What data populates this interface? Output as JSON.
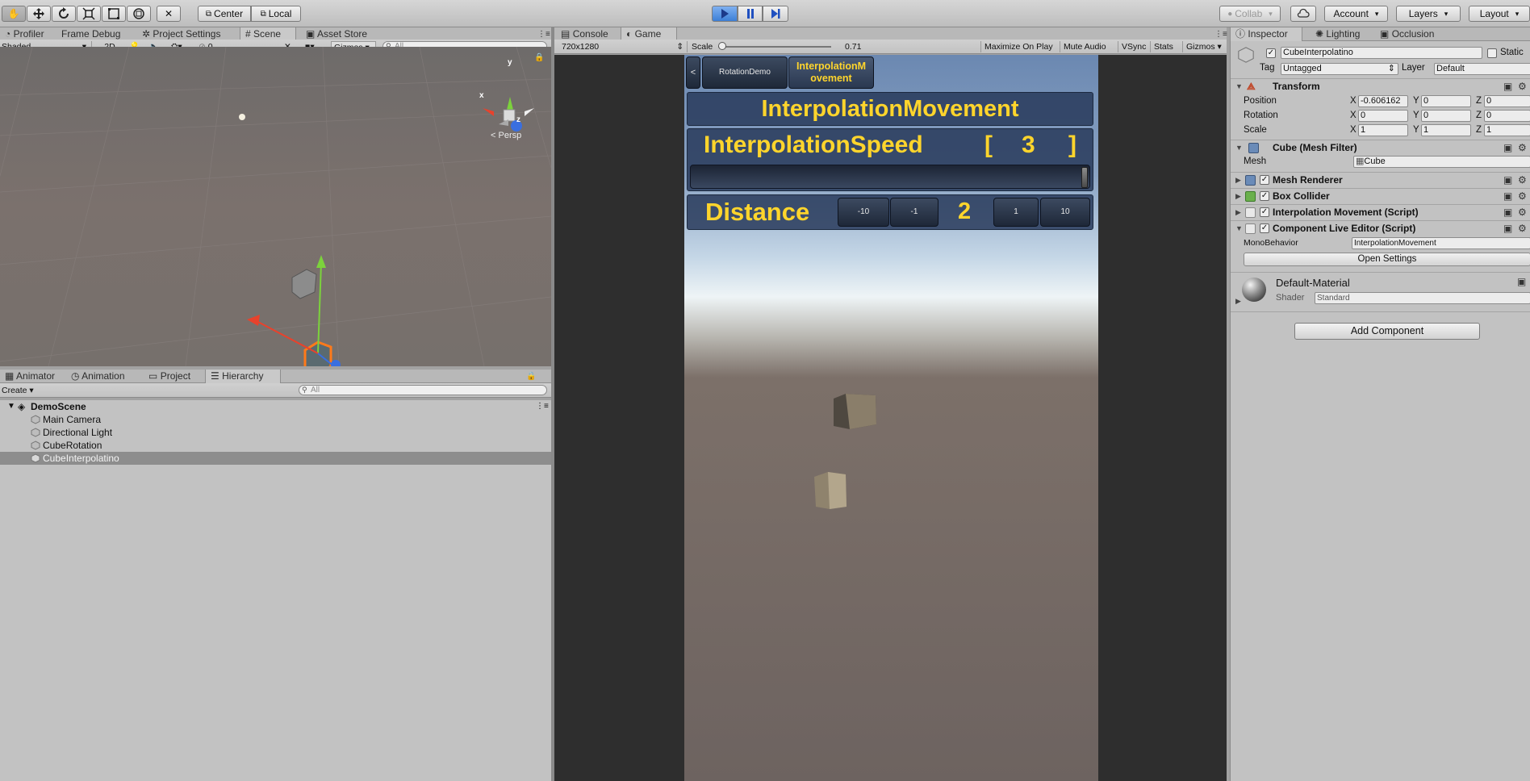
{
  "toolbar": {
    "pivot_center": "Center",
    "pivot_local": "Local",
    "collab": "Collab",
    "account": "Account",
    "layers": "Layers",
    "layout": "Layout"
  },
  "scene_tabs": [
    "Profiler",
    "Frame Debug",
    "Project Settings",
    "Scene",
    "Asset Store"
  ],
  "scene_bar": {
    "shading": "Shaded",
    "mode_2d": "2D",
    "fx_count": "0",
    "gizmos": "Gizmos",
    "search_placeholder": "All",
    "persp": "Persp",
    "axis_x": "x",
    "axis_y": "y",
    "axis_z": "z"
  },
  "hier_tabs": [
    "Animator",
    "Animation",
    "Project",
    "Hierarchy"
  ],
  "hierarchy": {
    "create": "Create",
    "search_placeholder": "All",
    "scene_name": "DemoScene",
    "items": [
      "Main Camera",
      "Directional Light",
      "CubeRotation",
      "CubeInterpolatino"
    ]
  },
  "game_tabs": [
    "Console",
    "Game"
  ],
  "game_bar": {
    "resolution": "720x1280",
    "scale_label": "Scale",
    "scale_value": "0.71",
    "scale_fraction": 0.0,
    "maximize": "Maximize On Play",
    "mute": "Mute Audio",
    "vsync": "VSync",
    "stats": "Stats",
    "gizmos": "Gizmos"
  },
  "game_ui": {
    "back": "<",
    "tab_rotation": "RotationDemo",
    "tab_interp": "InterpolationM ovement",
    "title": "InterpolationMovement",
    "speed_label": "InterpolationSpeed",
    "speed_open": "[",
    "speed_value": "3",
    "speed_close": "]",
    "speed_fraction": 1.0,
    "distance_label": "Distance",
    "btn_minus10": "-10",
    "btn_minus1": "-1",
    "distance_value": "2",
    "btn_plus1": "1",
    "btn_plus10": "10"
  },
  "inspector_tabs": [
    "Inspector",
    "Lighting",
    "Occlusion"
  ],
  "inspector": {
    "object_name": "CubeInterpolatino",
    "static": "Static",
    "tag_label": "Tag",
    "tag_value": "Untagged",
    "layer_label": "Layer",
    "layer_value": "Default",
    "transform": {
      "header": "Transform",
      "position_label": "Position",
      "rotation_label": "Rotation",
      "scale_label": "Scale",
      "x": "X",
      "y": "Y",
      "z": "Z",
      "position": [
        "-0.606162",
        "0",
        "0"
      ],
      "rotation": [
        "0",
        "0",
        "0"
      ],
      "scale": [
        "1",
        "1",
        "1"
      ]
    },
    "mesh_filter": {
      "header": "Cube (Mesh Filter)",
      "mesh_label": "Mesh",
      "mesh_value": "Cube"
    },
    "mesh_renderer": "Mesh Renderer",
    "box_collider": "Box Collider",
    "interp_script": "Interpolation Movement (Script)",
    "live_editor": {
      "header": "Component Live Editor (Script)",
      "mono_label": "MonoBehavior",
      "mono_value": "InterpolationMovement",
      "open_settings": "Open Settings"
    },
    "material": {
      "name": "Default-Material",
      "shader_label": "Shader",
      "shader_value": "Standard"
    },
    "add_component": "Add Component"
  }
}
